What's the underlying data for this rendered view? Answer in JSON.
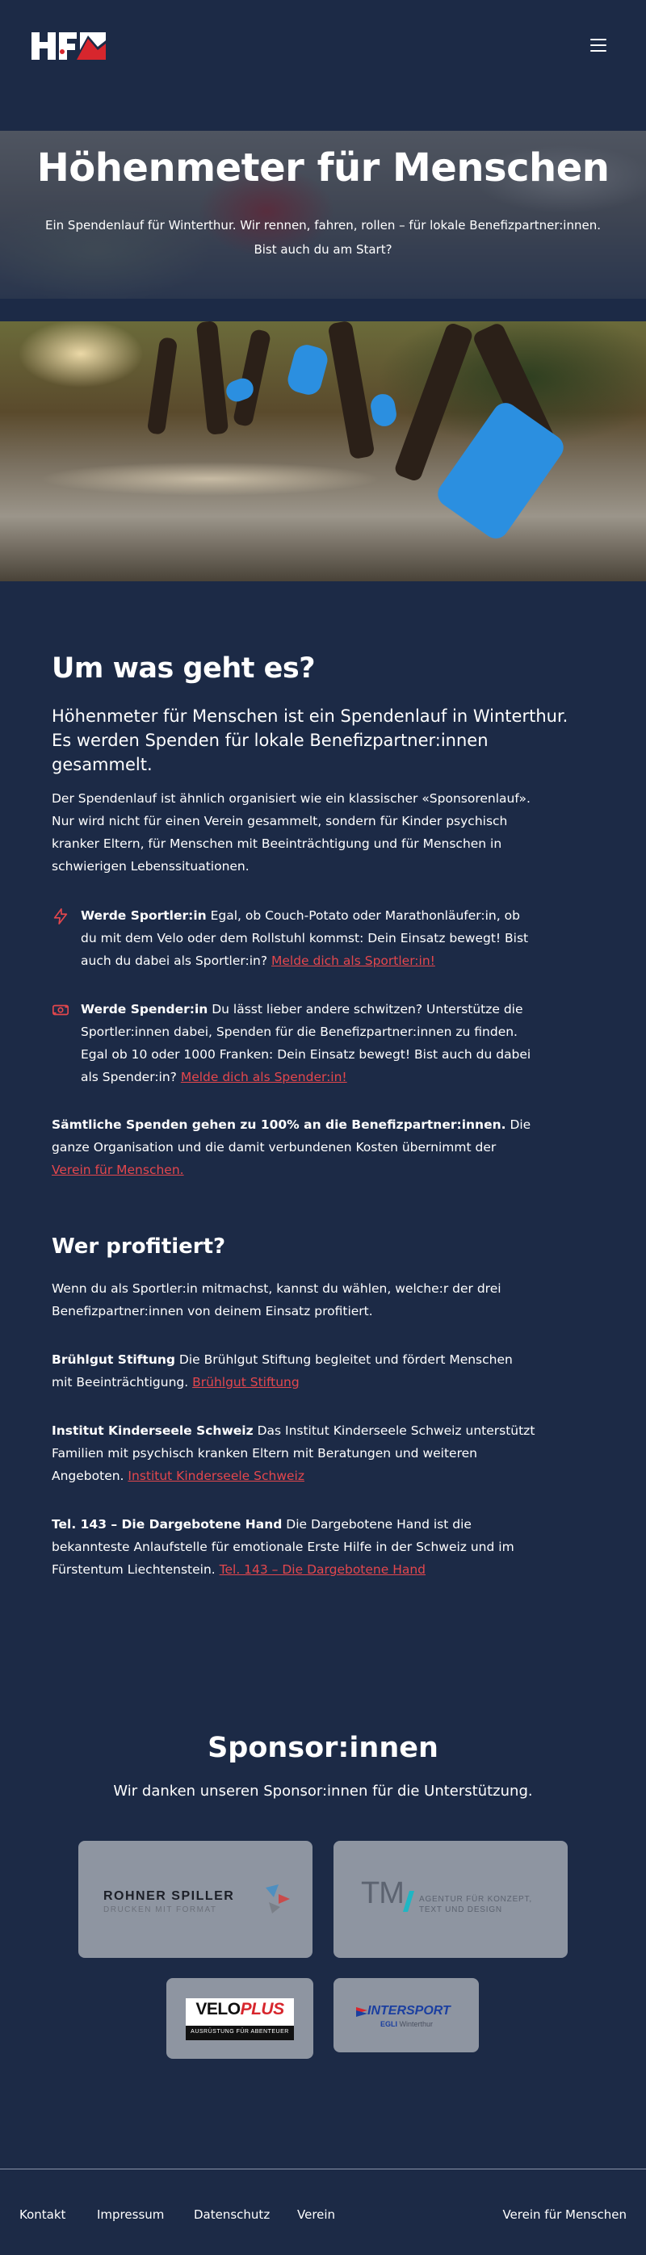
{
  "header": {
    "logo_text": "HfM",
    "menu_icon": "hamburger-menu-icon"
  },
  "hero": {
    "title": "Höhenmeter für Menschen",
    "subtitle": "Ein Spendenlauf für Winterthur. Wir rennen, fahren, rollen – für lokale Benefizpartner:innen. Bist auch du am Start?"
  },
  "about": {
    "heading": "Um was geht es?",
    "lead": "Höhenmeter für Menschen ist ein Spendenlauf in Winterthur. Es werden Spenden für lokale Benefizpartner:innen gesammelt.",
    "body": "Der Spendenlauf ist ähnlich organisiert wie ein klassischer «Sponsorenlauf». Nur wird nicht für einen Verein gesammelt, sondern für Kinder psychisch kranker Eltern, für Menschen mit Beeinträchtigung und für Menschen in schwierigen Lebenssituationen.",
    "features": [
      {
        "icon": "lightning-icon",
        "title": "Werde Sportler:in",
        "text": " Egal, ob Couch-Potato oder Marathonläufer:in, ob du mit dem Velo oder dem Rollstuhl kommst: Dein Einsatz bewegt! Bist auch du dabei als Sportler:in? ",
        "link": "Melde dich als Sportler:in!"
      },
      {
        "icon": "donation-cash-icon",
        "title": "Werde Spender:in",
        "text": " Du lässt lieber andere schwitzen? Unterstütze die Sportler:innen dabei, Spenden für die Benefizpartner:innen zu finden. Egal ob 10 oder 1000 Franken: Dein Einsatz bewegt! Bist auch du dabei als Spender:in? ",
        "link": "Melde dich als Spender:in!"
      }
    ],
    "donation_note_bold": "Sämtliche Spenden gehen zu 100% an die Benefizpartner:innen.",
    "donation_note_text": " Die ganze Organisation und die damit verbundenen Kosten übernimmt der ",
    "donation_note_link": "Verein für Menschen."
  },
  "beneficiaries": {
    "heading": "Wer profitiert?",
    "intro": "Wenn du als Sportler:in mitmachst, kannst du wählen, welche:r der drei Benefizpartner:innen von deinem Einsatz profitiert.",
    "items": [
      {
        "name": "Brühlgut Stiftung",
        "text": " Die Brühlgut Stiftung begleitet und fördert Menschen mit Beeinträchtigung. ",
        "link": "Brühlgut Stiftung"
      },
      {
        "name": "Institut Kinderseele Schweiz",
        "text": " Das Institut Kinderseele Schweiz unterstützt Familien mit psychisch kranken Eltern mit Beratungen und weiteren Angeboten. ",
        "link": "Institut Kinderseele Schweiz"
      },
      {
        "name": "Tel. 143 – Die Dargebotene Hand",
        "text": " Die Dargebotene Hand ist die bekannteste Anlaufstelle für emotionale Erste Hilfe in der Schweiz und im Fürstentum Liechtenstein. ",
        "link": "Tel. 143 – Die Dargebotene Hand"
      }
    ]
  },
  "sponsors": {
    "heading": "Sponsor:innen",
    "subtitle": "Wir danken unseren Sponsor:innen für die Unterstützung.",
    "logos": {
      "rohner_name": "ROHNER SPILLER",
      "rohner_tag": "DRUCKEN MIT FORMAT",
      "tm_name": "TM",
      "tm_tag": "AGENTUR FÜR KONZEPT, TEXT UND DESIGN",
      "velo_a": "VELO",
      "velo_b": "PLUS",
      "velo_tag": "AUSRÜSTUNG FÜR ABENTEUER",
      "intersport_name": "INTERSPORT",
      "intersport_tag_a": "EGLI",
      "intersport_tag_b": " Winterthur"
    }
  },
  "footer": {
    "links": [
      "Kontakt",
      "Impressum",
      "Datenschutz",
      "Verein"
    ],
    "right_link": "Verein für Menschen"
  },
  "colors": {
    "background": "#1c2a46",
    "accent_red": "#e4474d",
    "sponsor_card": "#8e95a1"
  }
}
